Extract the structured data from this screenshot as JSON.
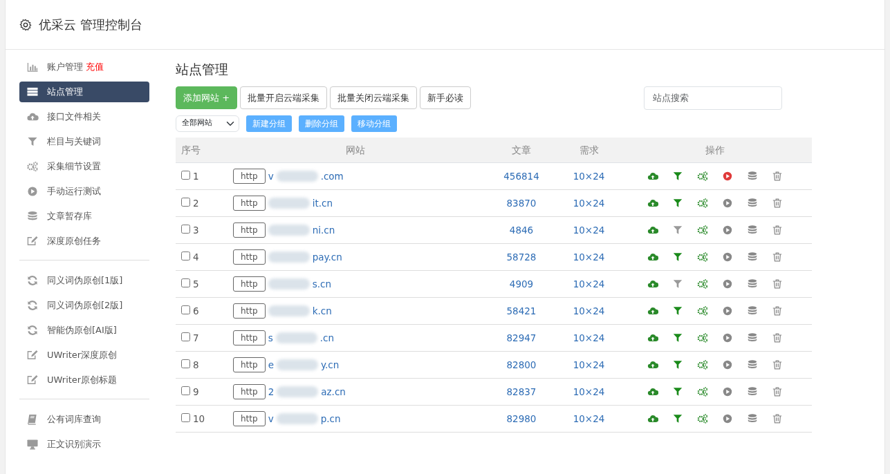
{
  "header": {
    "title": "优采云 管理控制台"
  },
  "sidebar": {
    "groups": [
      {
        "items": [
          {
            "label": "账户管理",
            "extra": "充值",
            "kind": "chart",
            "selected": false
          },
          {
            "label": "站点管理",
            "kind": "server",
            "selected": true
          },
          {
            "label": "接口文件相关",
            "kind": "cloud",
            "selected": false
          },
          {
            "label": "栏目与关键词",
            "kind": "filter",
            "selected": false
          },
          {
            "label": "采集细节设置",
            "kind": "gears",
            "selected": false
          },
          {
            "label": "手动运行测试",
            "kind": "play",
            "selected": false
          },
          {
            "label": "文章暂存库",
            "kind": "database",
            "selected": false
          },
          {
            "label": "深度原创任务",
            "kind": "edit",
            "selected": false
          }
        ]
      },
      {
        "items": [
          {
            "label": "同义词伪原创[1版]",
            "kind": "refresh",
            "selected": false
          },
          {
            "label": "同义词伪原创[2版]",
            "kind": "refresh",
            "selected": false
          },
          {
            "label": "智能伪原创[AI版]",
            "kind": "refresh",
            "selected": false
          },
          {
            "label": "UWriter深度原创",
            "kind": "edit",
            "selected": false
          },
          {
            "label": "UWriter原创标题",
            "kind": "edit",
            "selected": false
          }
        ]
      },
      {
        "items": [
          {
            "label": "公有词库查询",
            "kind": "book",
            "selected": false
          },
          {
            "label": "正文识别演示",
            "kind": "monitor",
            "selected": false
          }
        ]
      }
    ]
  },
  "main": {
    "title": "站点管理",
    "toolbar": [
      {
        "label": "添加网站 +",
        "kind": "primary"
      },
      {
        "label": "批量开启云端采集",
        "kind": "outline"
      },
      {
        "label": "批量关闭云端采集",
        "kind": "outline"
      },
      {
        "label": "新手必读",
        "kind": "outline"
      }
    ],
    "search": {
      "placeholder": "站点搜索"
    },
    "group_select": {
      "value": "全部网站"
    },
    "group_buttons": [
      "新建分组",
      "删除分组",
      "移动分组"
    ],
    "table": {
      "columns": [
        "序号",
        "网站",
        "文章",
        "需求",
        "操作"
      ],
      "rows": [
        {
          "num": "1",
          "checked": false,
          "scheme": "http",
          "site_start": "v",
          "site_end": ".com",
          "articles": "456814",
          "demand": "10×24",
          "filter_on": true,
          "running": true
        },
        {
          "num": "2",
          "checked": false,
          "scheme": "http",
          "site_start": "",
          "site_end": "it.cn",
          "articles": "83870",
          "demand": "10×24",
          "filter_on": true,
          "running": false
        },
        {
          "num": "3",
          "checked": false,
          "scheme": "http",
          "site_start": "",
          "site_end": "ni.cn",
          "articles": "4846",
          "demand": "10×24",
          "filter_on": false,
          "running": false
        },
        {
          "num": "4",
          "checked": false,
          "scheme": "http",
          "site_start": "",
          "site_end": "pay.cn",
          "articles": "58728",
          "demand": "10×24",
          "filter_on": true,
          "running": false
        },
        {
          "num": "5",
          "checked": false,
          "scheme": "http",
          "site_start": "",
          "site_end": "s.cn",
          "articles": "4909",
          "demand": "10×24",
          "filter_on": false,
          "running": false
        },
        {
          "num": "6",
          "checked": false,
          "scheme": "http",
          "site_start": "",
          "site_end": "k.cn",
          "articles": "58421",
          "demand": "10×24",
          "filter_on": true,
          "running": false
        },
        {
          "num": "7",
          "checked": false,
          "scheme": "http",
          "site_start": "s",
          "site_end": ".cn",
          "articles": "82947",
          "demand": "10×24",
          "filter_on": true,
          "running": false
        },
        {
          "num": "8",
          "checked": false,
          "scheme": "http",
          "site_start": "e",
          "site_end": "y.cn",
          "articles": "82800",
          "demand": "10×24",
          "filter_on": true,
          "running": false
        },
        {
          "num": "9",
          "checked": false,
          "scheme": "http",
          "site_start": "2",
          "site_end": "az.cn",
          "articles": "82837",
          "demand": "10×24",
          "filter_on": true,
          "running": false
        },
        {
          "num": "10",
          "checked": false,
          "scheme": "http",
          "site_start": "v",
          "site_end": "p.cn",
          "articles": "82980",
          "demand": "10×24",
          "filter_on": true,
          "running": false
        }
      ]
    }
  }
}
